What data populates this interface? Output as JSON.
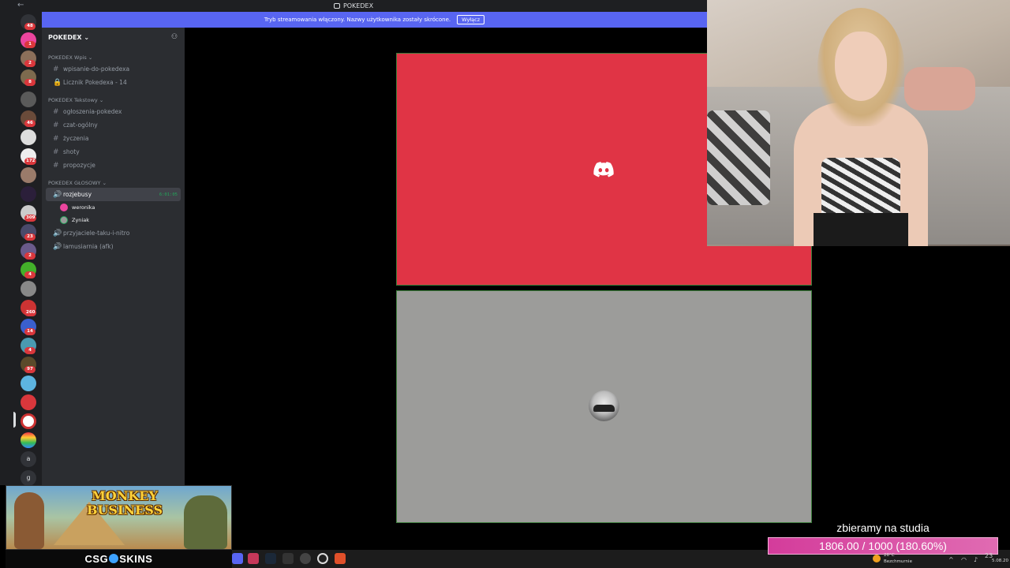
{
  "window": {
    "title": "POKEDEX"
  },
  "banner": {
    "text": "Tryb streamowania włączony. Nazwy użytkownika zostały skrócone.",
    "button": "Wyłącz"
  },
  "server": {
    "name": "POKEDEX"
  },
  "rail_badges": [
    "48",
    "1",
    "2",
    "8",
    "46",
    "172",
    "309",
    "23",
    "2",
    "4",
    "260",
    "14",
    "4",
    "97"
  ],
  "rail_letters": [
    "a",
    "g"
  ],
  "categories": [
    {
      "name": "POKEDEX Wpis",
      "channels": [
        {
          "name": "wpisanie-do-pokedexa",
          "type": "text"
        },
        {
          "name": "Licznik Pokedexa - 14",
          "type": "locked"
        }
      ]
    },
    {
      "name": "POKEDEX Tekstowy",
      "channels": [
        {
          "name": "ogłoszenia-pokedex",
          "type": "text"
        },
        {
          "name": "czat-ogólny",
          "type": "text"
        },
        {
          "name": "życzenia",
          "type": "text"
        },
        {
          "name": "shoty",
          "type": "text"
        },
        {
          "name": "propozycje",
          "type": "text"
        }
      ]
    },
    {
      "name": "POKEDEX GŁOSOWY",
      "channels": []
    }
  ],
  "voice": {
    "active_channel": "rozjebusy",
    "timer": "6:01:05",
    "users": [
      "weronika",
      "Zyniak"
    ],
    "other_channels": [
      "przyjaciele-taku-i-nitro",
      "lamusiarnia (afk)"
    ]
  },
  "ad": {
    "title_line1": "MONKEY",
    "title_line2": "BUSINESS",
    "brand_left": "CSG",
    "brand_right": "SKINS"
  },
  "goal": {
    "title": "zbieramy na studia",
    "progress_text": "1806.00 / 1000 (180.60%)",
    "current": 1806.0,
    "target": 1000,
    "percent": 180.6
  },
  "tray": {
    "weather_temp": "26°C",
    "weather_desc": "Bezchmurnie",
    "time": "23",
    "date": "5.08.20"
  },
  "colors": {
    "banner": "#5865f2",
    "red_tile": "#e03445",
    "grey_tile": "#9c9c9a",
    "goal_bar": "#d43c9b",
    "active_green": "#23a55a"
  }
}
